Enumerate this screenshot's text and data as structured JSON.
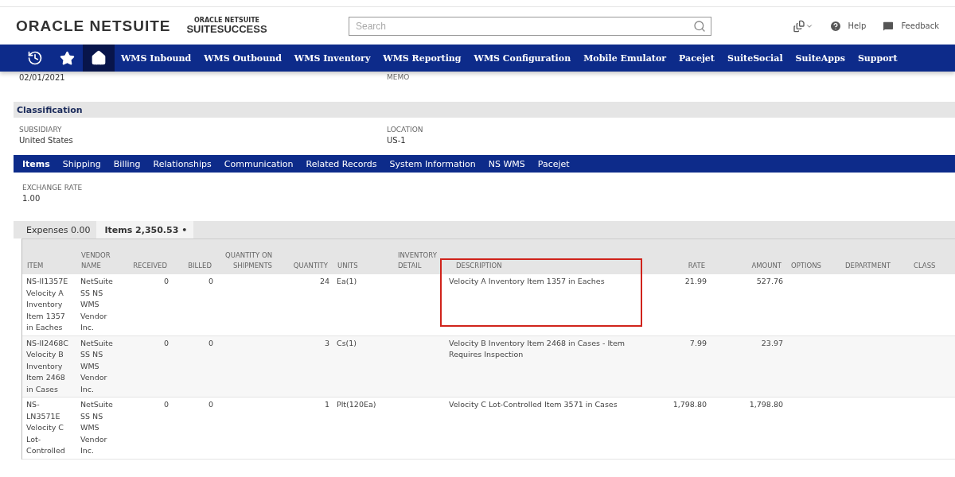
{
  "header": {
    "logo": "ORACLE NETSUITE",
    "sublogo_top": "ORACLE NETSUITE",
    "sublogo": "SUITESUCCESS",
    "search": {
      "placeholder": "Search"
    },
    "links": [
      "Help",
      "Feedback"
    ]
  },
  "nav": {
    "items": [
      {
        "label": "WMS Inbound"
      },
      {
        "label": "WMS Outbound"
      },
      {
        "label": "WMS Inventory"
      },
      {
        "label": "WMS Reporting"
      },
      {
        "label": "WMS Configuration"
      },
      {
        "label": "Mobile Emulator"
      },
      {
        "label": "Pacejet"
      },
      {
        "label": "SuiteSocial"
      },
      {
        "label": "SuiteApps"
      },
      {
        "label": "Support"
      }
    ]
  },
  "top_fields": [
    {
      "value": "02/01/2021"
    },
    {
      "label": "MEMO"
    }
  ],
  "section": {
    "title": "Classification",
    "fields": [
      {
        "label": "SUBSIDIARY",
        "value": "United States"
      },
      {
        "label": "LOCATION",
        "value": "US-1"
      }
    ]
  },
  "tabs": [
    {
      "label": "Items",
      "selected": true
    },
    {
      "label": "Shipping",
      "selected": false
    },
    {
      "label": "Billing",
      "selected": false
    },
    {
      "label": "Relationships",
      "selected": false
    },
    {
      "label": "Communication",
      "selected": false
    },
    {
      "label": "Related Records",
      "selected": false
    },
    {
      "label": "System Information",
      "selected": false
    },
    {
      "label": "NS WMS",
      "selected": false
    },
    {
      "label": "Pacejet",
      "selected": false
    }
  ],
  "exchange_rate": {
    "label": "EXCHANGE RATE",
    "value": "1.00"
  },
  "subtabs": [
    {
      "label": "Expenses 0.00",
      "selected": false
    },
    {
      "label": "Items 2,350.53 •",
      "selected": true
    }
  ],
  "table": {
    "columns": [
      {
        "label": "ITEM",
        "highlighted": false
      },
      {
        "label": "VENDOR NAME",
        "highlighted": false
      },
      {
        "label": "RECEIVED",
        "highlighted": false
      },
      {
        "label": "BILLED",
        "highlighted": false
      },
      {
        "label": "QUANTITY ON SHIPMENTS",
        "highlighted": false
      },
      {
        "label": "QUANTITY",
        "highlighted": false
      },
      {
        "label": "UNITS",
        "highlighted": false
      },
      {
        "label": "INVENTORY DETAIL",
        "highlighted": false
      },
      {
        "label": "DESCRIPTION",
        "highlighted": true
      },
      {
        "label": "RATE",
        "highlighted": false
      },
      {
        "label": "AMOUNT",
        "highlighted": false
      },
      {
        "label": "OPTIONS",
        "highlighted": false
      },
      {
        "label": "DEPARTMENT",
        "highlighted": false
      },
      {
        "label": "CLASS",
        "highlighted": false
      }
    ],
    "rows": [
      [
        "NS-II1357E Velocity A Inventory Item 1357 in Eaches",
        "NetSuite SS NS WMS Vendor Inc.",
        "0",
        "0",
        "",
        "24",
        "Ea(1)",
        "",
        "Velocity A Inventory Item 1357 in Eaches",
        "21.99",
        "527.76",
        "",
        "",
        ""
      ],
      [
        "NS-II2468C Velocity B Inventory Item 2468 in Cases",
        "NetSuite SS NS WMS Vendor Inc.",
        "0",
        "0",
        "",
        "3",
        "Cs(1)",
        "",
        "Velocity B Inventory Item 2468 in Cases - Item Requires Inspection",
        "7.99",
        "23.97",
        "",
        "",
        ""
      ],
      [
        "NS-LN3571E Velocity C Lot-Controlled",
        "NetSuite SS NS WMS Vendor Inc.",
        "0",
        "0",
        "",
        "1",
        "Plt(120Ea)",
        "",
        "Velocity C Lot-Controlled Item 3571 in Cases",
        "1,798.80",
        "1,798.80",
        "",
        "",
        ""
      ]
    ]
  }
}
